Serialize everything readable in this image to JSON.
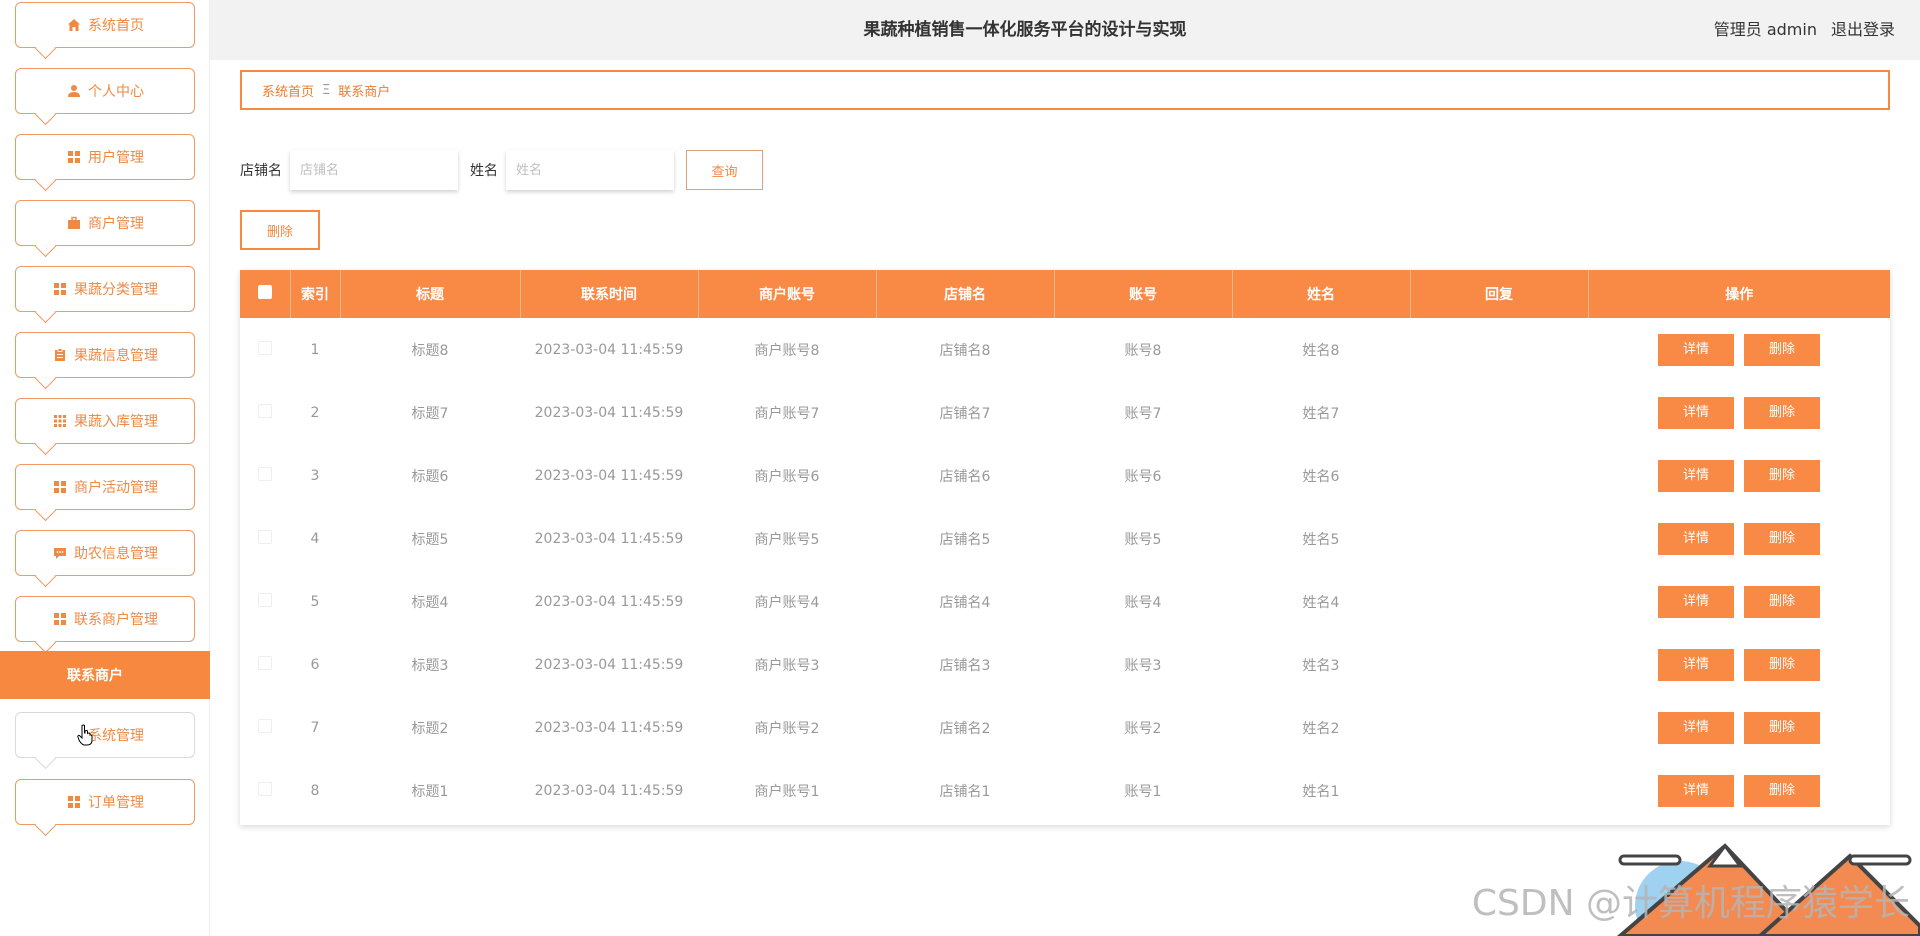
{
  "header": {
    "title": "果蔬种植销售一体化服务平台的设计与实现",
    "user": "管理员 admin",
    "logout": "退出登录"
  },
  "sidebar": {
    "items": [
      {
        "label": "系统首页",
        "icon": "home-icon"
      },
      {
        "label": "个人中心",
        "icon": "user-icon"
      },
      {
        "label": "用户管理",
        "icon": "grid-icon"
      },
      {
        "label": "商户管理",
        "icon": "briefcase-icon"
      },
      {
        "label": "果蔬分类管理",
        "icon": "grid-icon"
      },
      {
        "label": "果蔬信息管理",
        "icon": "clipboard-icon"
      },
      {
        "label": "果蔬入库管理",
        "icon": "apps-icon"
      },
      {
        "label": "商户活动管理",
        "icon": "grid-icon"
      },
      {
        "label": "助农信息管理",
        "icon": "chat-icon"
      },
      {
        "label": "联系商户管理",
        "icon": "grid-icon"
      },
      {
        "label": "系统管理",
        "icon": "none"
      },
      {
        "label": "订单管理",
        "icon": "grid-icon"
      }
    ],
    "active_sub": "联系商户"
  },
  "breadcrumb": {
    "home": "系统首页",
    "separator": "Ξ",
    "current": "联系商户"
  },
  "search": {
    "shop_label": "店铺名",
    "shop_placeholder": "店铺名",
    "name_label": "姓名",
    "name_placeholder": "姓名",
    "query_button": "查询"
  },
  "bulk_delete": "删除",
  "table": {
    "columns": [
      "索引",
      "标题",
      "联系时间",
      "商户账号",
      "店铺名",
      "账号",
      "姓名",
      "回复",
      "操作"
    ],
    "rows": [
      {
        "index": "1",
        "title": "标题8",
        "time": "2023-03-04 11:45:59",
        "merchant": "商户账号8",
        "shop": "店铺名8",
        "account": "账号8",
        "name": "姓名8",
        "reply": ""
      },
      {
        "index": "2",
        "title": "标题7",
        "time": "2023-03-04 11:45:59",
        "merchant": "商户账号7",
        "shop": "店铺名7",
        "account": "账号7",
        "name": "姓名7",
        "reply": ""
      },
      {
        "index": "3",
        "title": "标题6",
        "time": "2023-03-04 11:45:59",
        "merchant": "商户账号6",
        "shop": "店铺名6",
        "account": "账号6",
        "name": "姓名6",
        "reply": ""
      },
      {
        "index": "4",
        "title": "标题5",
        "time": "2023-03-04 11:45:59",
        "merchant": "商户账号5",
        "shop": "店铺名5",
        "account": "账号5",
        "name": "姓名5",
        "reply": ""
      },
      {
        "index": "5",
        "title": "标题4",
        "time": "2023-03-04 11:45:59",
        "merchant": "商户账号4",
        "shop": "店铺名4",
        "account": "账号4",
        "name": "姓名4",
        "reply": ""
      },
      {
        "index": "6",
        "title": "标题3",
        "time": "2023-03-04 11:45:59",
        "merchant": "商户账号3",
        "shop": "店铺名3",
        "account": "账号3",
        "name": "姓名3",
        "reply": ""
      },
      {
        "index": "7",
        "title": "标题2",
        "time": "2023-03-04 11:45:59",
        "merchant": "商户账号2",
        "shop": "店铺名2",
        "account": "账号2",
        "name": "姓名2",
        "reply": ""
      },
      {
        "index": "8",
        "title": "标题1",
        "time": "2023-03-04 11:45:59",
        "merchant": "商户账号1",
        "shop": "店铺名1",
        "account": "账号1",
        "name": "姓名1",
        "reply": ""
      }
    ],
    "detail_button": "详情",
    "delete_button": "删除"
  },
  "watermark": "CSDN @计算机程序猿学长",
  "colors": {
    "accent": "#f98a46",
    "accent_text": "#ee8a44",
    "header_bg": "#f3f2f2"
  }
}
